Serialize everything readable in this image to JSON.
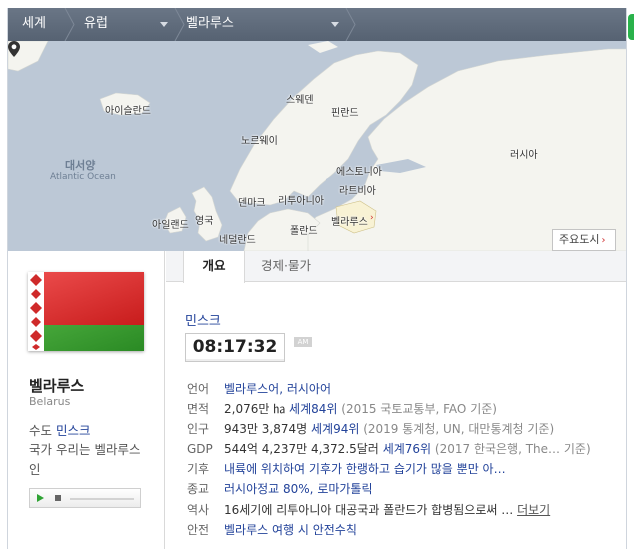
{
  "breadcrumb": {
    "items": [
      "세계",
      "유럽",
      "벨라루스"
    ]
  },
  "map": {
    "labels": {
      "iceland": "아이슬란드",
      "sweden": "스웨덴",
      "finland": "핀란드",
      "norway": "노르웨이",
      "atlantic_ko": "대서양",
      "atlantic_en": "Atlantic Ocean",
      "russia": "러시아",
      "estonia": "에스토니아",
      "latvia": "라트비아",
      "denmark": "덴마크",
      "lithuania": "리투아니아",
      "belarus": "벨라루스",
      "ireland": "아일랜드",
      "uk": "영국",
      "poland": "폴란드",
      "netherlands": "네덜란드"
    },
    "major_cities_button": "주요도시"
  },
  "country": {
    "name": "벨라루스",
    "name_en": "Belarus",
    "capital_label": "수도",
    "capital": "민스크",
    "anthem_label": "국가",
    "anthem": "우리는 벨라루스인"
  },
  "tabs": [
    "개요",
    "경제·물가"
  ],
  "overview": {
    "capital": "민스크",
    "time": "08:17:32",
    "ampm": "AM",
    "rows": {
      "language": {
        "k": "언어",
        "v": "벨라루스어, 러시아어"
      },
      "area": {
        "k": "면적",
        "v": "2,076만 ㏊",
        "rank": "세계84위",
        "src": "(2015 국토교통부, FAO 기준)"
      },
      "population": {
        "k": "인구",
        "v": "943만 3,874명",
        "rank": "세계94위",
        "src": "(2019 통계청, UN, 대만통계청 기준)"
      },
      "gdp": {
        "k": "GDP",
        "v": "544억 4,237만 4,372.5달러",
        "rank": "세계76위",
        "src": "(2017 한국은행, The…   기준)"
      },
      "climate": {
        "k": "기후",
        "v": "내륙에 위치하여 기후가 한랭하고 습기가 많을 뿐만 아…"
      },
      "religion": {
        "k": "종교",
        "v": "러시아정교 80%, 로마가톨릭"
      },
      "history": {
        "k": "역사",
        "v": "16세기에 리투아니아 대공국과 폴란드가 합병됨으로써 …",
        "more": "더보기"
      },
      "safety": {
        "k": "안전",
        "v": "벨라루스 여행 시 안전수칙"
      }
    }
  }
}
